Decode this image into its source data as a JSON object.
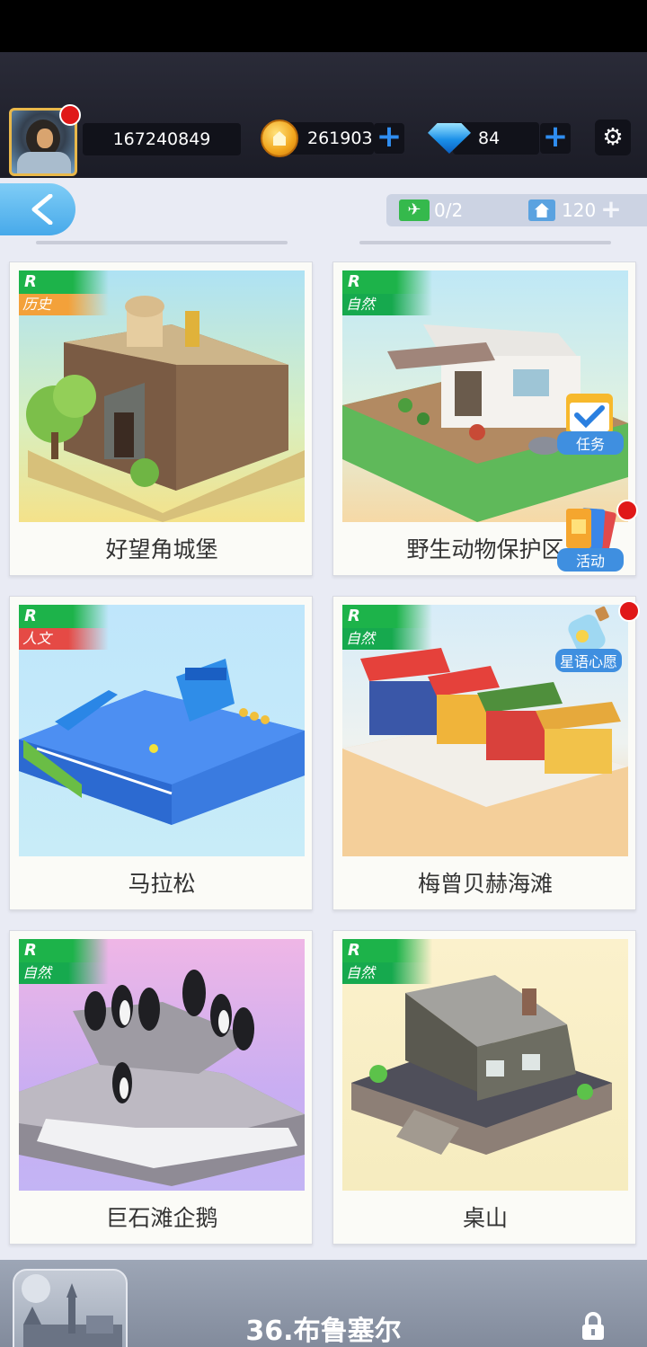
{
  "header": {
    "player_id": "167240849",
    "coins": "261903",
    "gems": "84",
    "plus_label": "+"
  },
  "nav": {
    "flights": "0/2",
    "buildings": "120",
    "plus_label": "+"
  },
  "cards": [
    {
      "rank": "R",
      "category": "历史",
      "name": "好望角城堡"
    },
    {
      "rank": "R",
      "category": "自然",
      "name": "野生动物保护区"
    },
    {
      "rank": "R",
      "category": "人文",
      "name": "马拉松"
    },
    {
      "rank": "R",
      "category": "自然",
      "name": "梅曾贝赫海滩"
    },
    {
      "rank": "R",
      "category": "自然",
      "name": "巨石滩企鹅"
    },
    {
      "rank": "R",
      "category": "自然",
      "name": "桌山"
    }
  ],
  "side_buttons": {
    "task": "任务",
    "event": "活动",
    "wish": "星语心愿"
  },
  "footer": {
    "city_title": "36.布鲁塞尔"
  }
}
